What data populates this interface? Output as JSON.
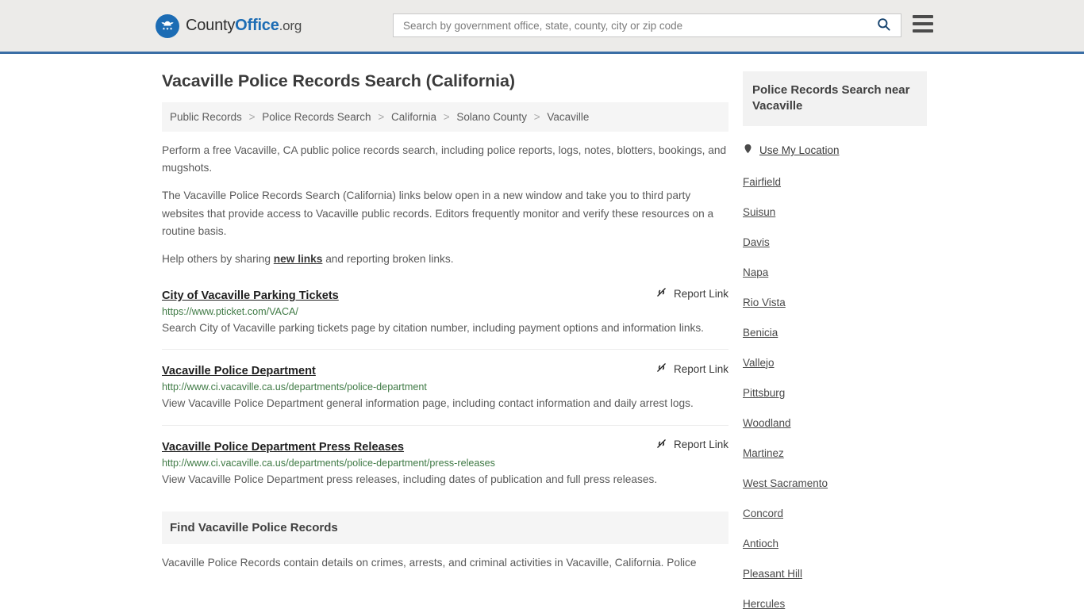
{
  "header": {
    "brand": {
      "part1": "County",
      "part2": "Office",
      "part3": ".org",
      "logo_icon": "eagle-seal-icon"
    },
    "search": {
      "placeholder": "Search by government office, state, county, city or zip code",
      "value": "",
      "icon": "search-icon"
    },
    "menu_icon": "hamburger-menu-icon",
    "accent_color": "#3a6ea5",
    "background_color": "#ecebe9"
  },
  "page": {
    "title": "Vacaville Police Records Search (California)"
  },
  "breadcrumb": {
    "separator": ">",
    "items": [
      {
        "label": "Public Records"
      },
      {
        "label": "Police Records Search"
      },
      {
        "label": "California"
      },
      {
        "label": "Solano County"
      },
      {
        "label": "Vacaville"
      }
    ]
  },
  "intro": {
    "p1": "Perform a free Vacaville, CA public police records search, including police reports, logs, notes, blotters, bookings, and mugshots.",
    "p2": "The Vacaville Police Records Search (California) links below open in a new window and take you to third party websites that provide access to Vacaville public records. Editors frequently monitor and verify these resources on a routine basis.",
    "p3_before": "Help others by sharing ",
    "p3_link": "new links",
    "p3_after": " and reporting broken links."
  },
  "results": {
    "report_label": "Report Link",
    "report_icon": "broken-link-icon",
    "items": [
      {
        "title": "City of Vacaville Parking Tickets",
        "url": "https://www.pticket.com/VACA/",
        "description": "Search City of Vacaville parking tickets page by citation number, including payment options and information links."
      },
      {
        "title": "Vacaville Police Department",
        "url": "http://www.ci.vacaville.ca.us/departments/police-department",
        "description": "View Vacaville Police Department general information page, including contact information and daily arrest logs."
      },
      {
        "title": "Vacaville Police Department Press Releases",
        "url": "http://www.ci.vacaville.ca.us/departments/police-department/press-releases",
        "description": "View Vacaville Police Department press releases, including dates of publication and full press releases."
      }
    ]
  },
  "find_section": {
    "heading": "Find Vacaville Police Records",
    "body": "Vacaville Police Records contain details on crimes, arrests, and criminal activities in Vacaville, California. Police"
  },
  "sidebar": {
    "heading": "Police Records Search near Vacaville",
    "use_location": {
      "label": "Use My Location",
      "icon": "map-pin-icon"
    },
    "cities": [
      {
        "label": "Fairfield"
      },
      {
        "label": "Suisun"
      },
      {
        "label": "Davis"
      },
      {
        "label": "Napa"
      },
      {
        "label": "Rio Vista"
      },
      {
        "label": "Benicia"
      },
      {
        "label": "Vallejo"
      },
      {
        "label": "Pittsburg"
      },
      {
        "label": "Woodland"
      },
      {
        "label": "Martinez"
      },
      {
        "label": "West Sacramento"
      },
      {
        "label": "Concord"
      },
      {
        "label": "Antioch"
      },
      {
        "label": "Pleasant Hill"
      },
      {
        "label": "Hercules"
      }
    ]
  }
}
